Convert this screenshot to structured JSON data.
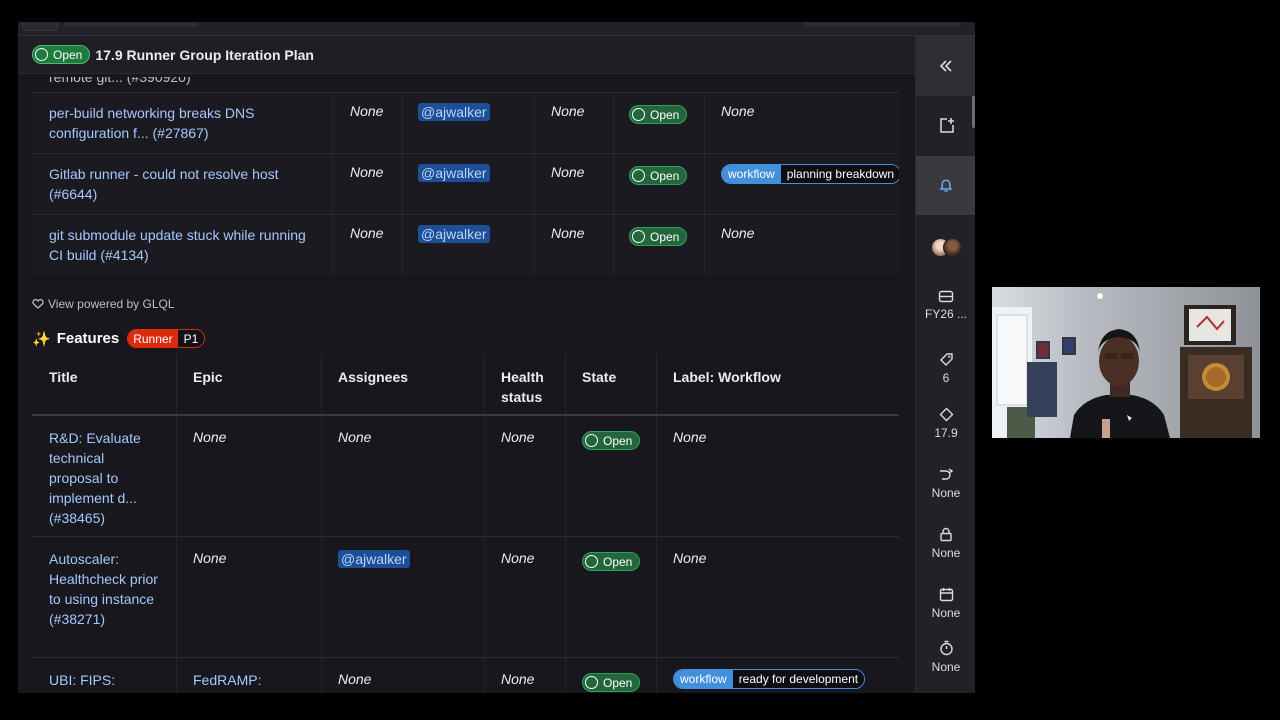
{
  "colors": {
    "open_green": "#24663b",
    "link_blue": "#a4c8ff",
    "scoped_blue": "#428fdc",
    "runner_red": "#dd2b0e",
    "bg_dark": "#18171d"
  },
  "sticky_header": {
    "state": "Open",
    "title": "17.9 Runner Group Iteration Plan"
  },
  "clipped_text": "remote git... (#390920)",
  "issues_table": [
    {
      "title": "per-build networking breaks DNS configuration f... (#27867)",
      "epic": "None",
      "assignee": "@ajwalker",
      "health": "None",
      "state": "Open",
      "label": "None"
    },
    {
      "title": "Gitlab runner - could not resolve host (#6644)",
      "epic": "None",
      "assignee": "@ajwalker",
      "health": "None",
      "state": "Open",
      "label_key": "workflow",
      "label_value": "planning breakdown"
    },
    {
      "title": "git submodule update stuck while running CI build (#4134)",
      "epic": "None",
      "assignee": "@ajwalker",
      "health": "None",
      "state": "Open",
      "label": "None"
    }
  ],
  "view_powered": {
    "view": "View",
    "rest": "powered by GLQL"
  },
  "features": {
    "heading": "Features",
    "label_key": "Runner",
    "label_value": "P1",
    "columns": [
      "Title",
      "Epic",
      "Assignees",
      "Health status",
      "State",
      "Label: Workflow"
    ],
    "rows": [
      {
        "title": "R&D: Evaluate technical proposal to implement d... (#38465)",
        "epic": "None",
        "assignees": "None",
        "health": "None",
        "state": "Open",
        "label": "None"
      },
      {
        "title": "Autoscaler: Healthcheck prior to using instance (#38271)",
        "epic": "None",
        "assignees": "@ajwalker",
        "health": "None",
        "state": "Open",
        "label": "None"
      },
      {
        "title": "UBI: FIPS:",
        "epic": "FedRAMP:",
        "assignees": "None",
        "health": "None",
        "state": "Open",
        "label_key": "workflow",
        "label_value": "ready for development"
      }
    ]
  },
  "sidebar": {
    "icons": [
      "collapse-icon",
      "todo-add-icon",
      "notification-bell-icon",
      "avatars",
      "iteration-icon",
      "weight-icon",
      "milestone-icon",
      "merge-icon",
      "lock-icon",
      "calendar-icon",
      "timer-icon"
    ],
    "iteration": "FY26 ...",
    "weight": "6",
    "milestone": "17.9",
    "parent": "None",
    "confidential": "None",
    "due_date": "None",
    "time_tracking": "None"
  }
}
